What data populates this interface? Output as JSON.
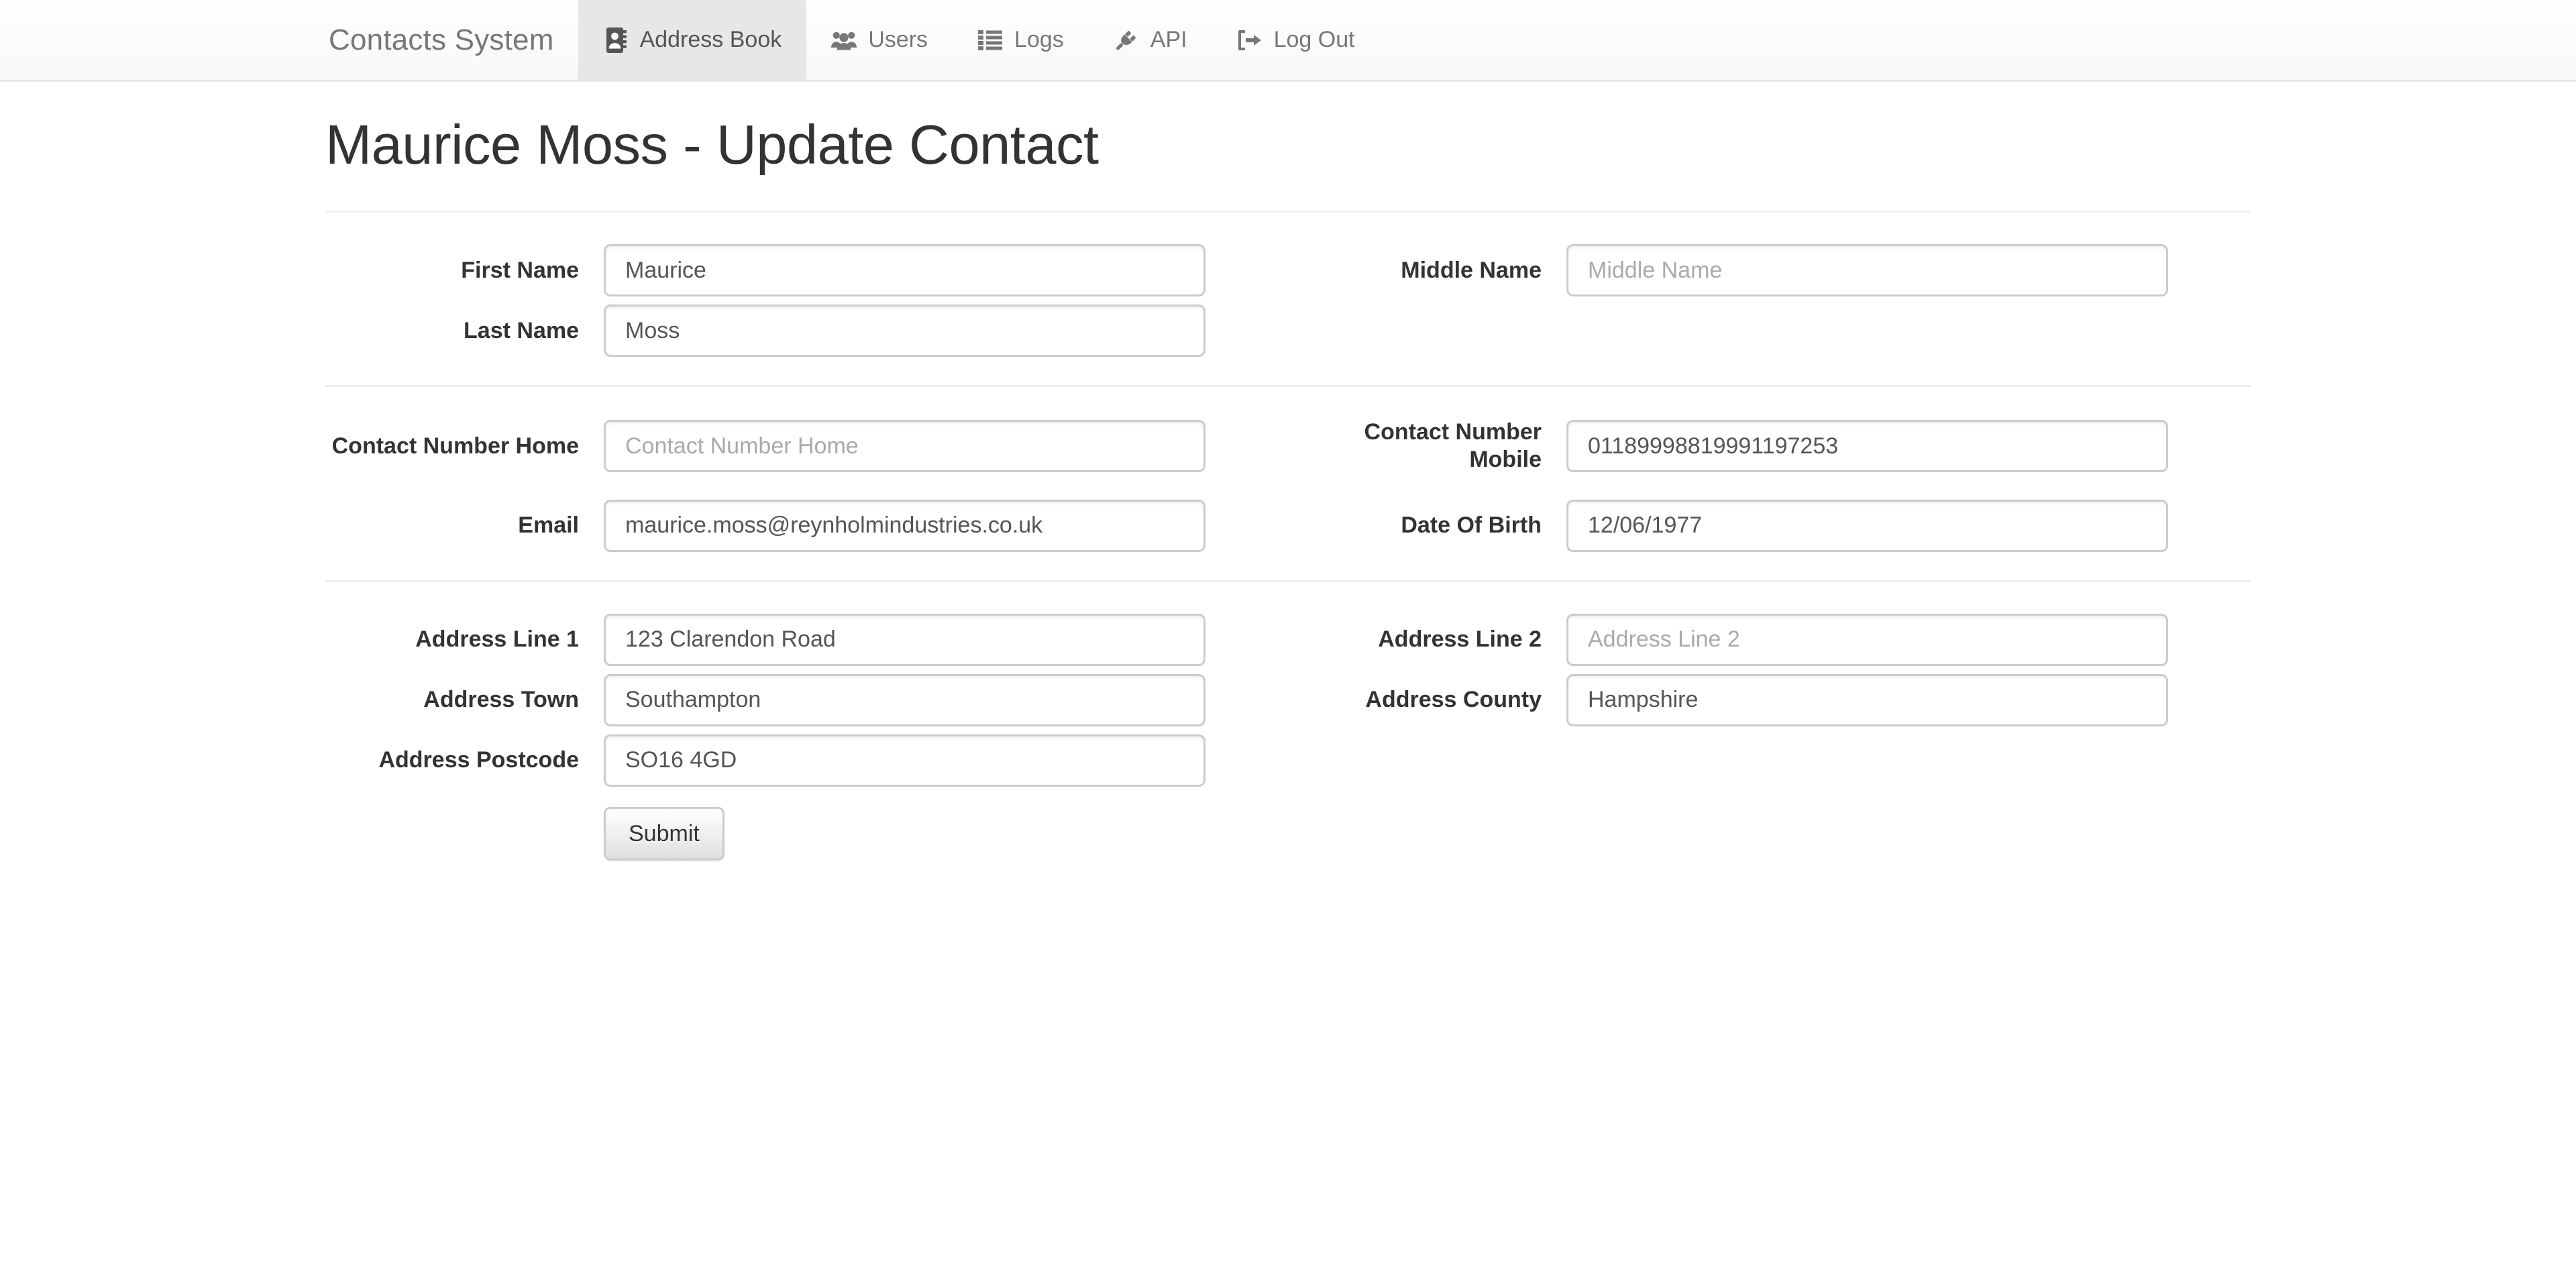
{
  "navbar": {
    "brand": "Contacts System",
    "items": [
      {
        "label": "Address Book",
        "icon": "address-book-icon",
        "active": true
      },
      {
        "label": "Users",
        "icon": "users-icon",
        "active": false
      },
      {
        "label": "Logs",
        "icon": "list-icon",
        "active": false
      },
      {
        "label": "API",
        "icon": "plug-icon",
        "active": false
      },
      {
        "label": "Log Out",
        "icon": "sign-out-icon",
        "active": false
      }
    ]
  },
  "page": {
    "title": "Maurice Moss - Update Contact"
  },
  "form": {
    "fields": {
      "first_name": {
        "label": "First Name",
        "value": "Maurice",
        "placeholder": "First Name"
      },
      "middle_name": {
        "label": "Middle Name",
        "value": "",
        "placeholder": "Middle Name"
      },
      "last_name": {
        "label": "Last Name",
        "value": "Moss",
        "placeholder": "Last Name"
      },
      "contact_number_home": {
        "label": "Contact Number Home",
        "value": "",
        "placeholder": "Contact Number Home"
      },
      "contact_number_mobile": {
        "label": "Contact Number Mobile",
        "value": "01189998819991197253",
        "placeholder": "Contact Number Mobile"
      },
      "email": {
        "label": "Email",
        "value": "maurice.moss@reynholmindustries.co.uk",
        "placeholder": "Email"
      },
      "date_of_birth": {
        "label": "Date Of Birth",
        "value": "12/06/1977",
        "placeholder": "Date Of Birth"
      },
      "address_line_1": {
        "label": "Address Line 1",
        "value": "123 Clarendon Road",
        "placeholder": "Address Line 1"
      },
      "address_line_2": {
        "label": "Address Line 2",
        "value": "",
        "placeholder": "Address Line 2"
      },
      "address_town": {
        "label": "Address Town",
        "value": "Southampton",
        "placeholder": "Address Town"
      },
      "address_county": {
        "label": "Address County",
        "value": "Hampshire",
        "placeholder": "Address County"
      },
      "address_postcode": {
        "label": "Address Postcode",
        "value": "SO16 4GD",
        "placeholder": "Address Postcode"
      }
    },
    "submit_label": "Submit"
  },
  "colors": {
    "navbar_bg": "#f8f8f8",
    "navbar_border": "#e7e7e7",
    "active_tab_bg": "#e7e7e7",
    "nav_text": "#777777",
    "label_text": "#333333",
    "input_border": "#cccccc",
    "input_text": "#555555",
    "placeholder_text": "#aaaaaa",
    "rule": "#eeeeee"
  }
}
